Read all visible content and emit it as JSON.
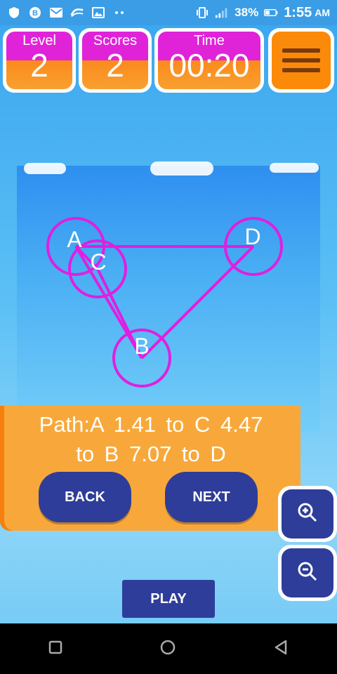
{
  "status_bar": {
    "battery_percent": "38%",
    "time": "1:55",
    "ampm": "AM",
    "icons": [
      "shield-icon",
      "browser-icon",
      "gmail-icon",
      "swype-icon",
      "gallery-icon",
      "more-dots-icon",
      "vibrate-icon",
      "signal-icon",
      "battery-icon"
    ]
  },
  "hud": {
    "level_label": "Level",
    "level_value": "2",
    "scores_label": "Scores",
    "scores_value": "2",
    "time_label": "Time",
    "time_value": "00:20"
  },
  "graph": {
    "nodes": [
      {
        "label": "A"
      },
      {
        "label": "C"
      },
      {
        "label": "D"
      },
      {
        "label": "B"
      }
    ],
    "path_order": [
      "A",
      "C",
      "B",
      "D",
      "A"
    ],
    "colors": {
      "edge": "#e01fe0",
      "node_text": "#ffffff"
    }
  },
  "info": {
    "path_line1": "Path:A    1.41  to C     4.47",
    "path_line2": "to B    7.07 to D",
    "back_label": "BACK",
    "next_label": "NEXT"
  },
  "play_label": "PLAY",
  "colors": {
    "button": "#2e3d99",
    "panel": "#f8a83a",
    "menu": "#fb8a0a"
  }
}
